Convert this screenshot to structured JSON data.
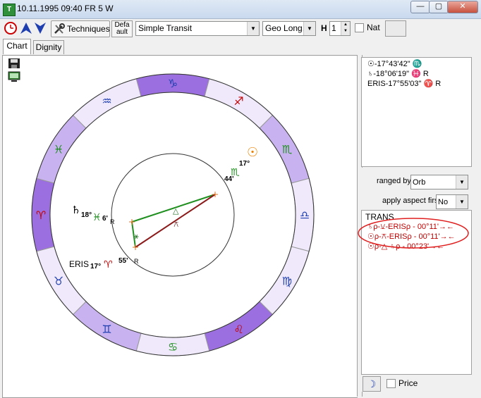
{
  "window": {
    "title": "10.11.1995  09:40 FR  5 W",
    "app_icon_text": "T",
    "controls": {
      "minimize": "—",
      "maximize": "▢",
      "close": "✕"
    }
  },
  "toolbar": {
    "techniques_label": "Techniques",
    "default_line1": "Defa",
    "default_line2": "ault",
    "chart_type_value": "Simple Transit",
    "coordinate_value": "Geo Long.",
    "h_label": "H",
    "h_value": "1",
    "nat_label": "Nat"
  },
  "tabs": [
    {
      "label": "Chart"
    },
    {
      "label": "Dignity"
    }
  ],
  "chart": {
    "zodiac_signs": [
      "♑",
      "♐",
      "♏",
      "♎",
      "♍",
      "♌",
      "♋",
      "♊",
      "♉",
      "♈",
      "♓",
      "♒"
    ],
    "saturn_label": "♄",
    "saturn_deg": "18°",
    "saturn_sign": "♓",
    "saturn_min": "6'",
    "saturn_retro": "R",
    "eris_label": "ERIS",
    "eris_deg": "17°",
    "eris_sign": "♈",
    "eris_min": "55'",
    "eris_retro": "R",
    "sun_symbol": "☉",
    "sun_deg": "17°",
    "sun_sign": "♏",
    "sun_min": "44'",
    "aspect_sextile": "⚹",
    "aspect_trine": "△",
    "aspect_quincunx": "⚻"
  },
  "positions": [
    {
      "text": "☉-17°43'42\" ♏"
    },
    {
      "text": "♄-18°06'19\" ♓ R"
    },
    {
      "text": "ERIS-17°55'03\" ♈ R"
    }
  ],
  "sort": {
    "ranged_by_label": "ranged by",
    "ranged_by_value": "Orb",
    "apply_label": "apply aspect first",
    "apply_value": "No"
  },
  "transits": {
    "header": "TRANS",
    "items": [
      {
        "text": "♄ρ-⚺-ERISρ - 00°11'→←"
      },
      {
        "text": "☉ρ-⚻-ERISρ - 00°11'→←"
      },
      {
        "text": "☉ρ-△-♄ρ - 00°23'→←"
      }
    ]
  },
  "bottom": {
    "moon_icon_text": "☽",
    "price_label": "Price"
  },
  "colors": {
    "house_dark": "#9b6fe0",
    "house_light": "#efe9fb",
    "house_mid": "#c8b2f0",
    "trans_red": "#c00000",
    "sun_orange": "#f08000",
    "aspect_green": "#1f8f1f",
    "aspect_maroon": "#8b1a1a",
    "highlight_red": "#e02020"
  }
}
